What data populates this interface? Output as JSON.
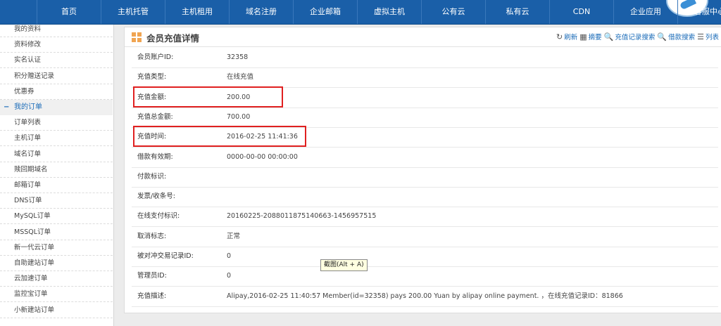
{
  "nav": {
    "items": [
      "首页",
      "主机托管",
      "主机租用",
      "域名注册",
      "企业邮箱",
      "虚拟主机",
      "公有云",
      "私有云",
      "CDN",
      "企业应用",
      "客服中心"
    ]
  },
  "sidebar": {
    "items_top": [
      "我的资料",
      "资料修改",
      "实名认证",
      "积分赠送记录",
      "优惠券"
    ],
    "group_label": "我的订单",
    "group_toggle": "−",
    "order_items": [
      "订单列表",
      "主机订单",
      "域名订单",
      "赎回期域名",
      "邮箱订单",
      "DNS订单",
      "MySQL订单",
      "MSSQL订单",
      "新一代云订单",
      "自助建站订单",
      "云加速订单",
      "监控宝订单",
      "小新建站订单"
    ]
  },
  "panel": {
    "title": "会员充值详情",
    "toolbar": [
      {
        "icon": "refresh-icon",
        "glyph": "↻",
        "label": "刷新"
      },
      {
        "icon": "summary-grid-icon",
        "glyph": "▦",
        "label": "摘要"
      },
      {
        "icon": "search-icon",
        "glyph": "🔍",
        "label": "充值记录搜索"
      },
      {
        "icon": "search-icon",
        "glyph": "🔍",
        "label": "借款搜索"
      },
      {
        "icon": "list-icon",
        "glyph": "☰",
        "label": "列表"
      }
    ]
  },
  "details": [
    {
      "label": "会员账户ID:",
      "value": "32358"
    },
    {
      "label": "充值类型:",
      "value": "在线充值"
    },
    {
      "label": "充值金额:",
      "value": "200.00"
    },
    {
      "label": "充值总金额:",
      "value": "700.00"
    },
    {
      "label": "充值时间:",
      "value": "2016-02-25 11:41:36"
    },
    {
      "label": "借款有效期:",
      "value": "0000-00-00 00:00:00"
    },
    {
      "label": "付款标识:",
      "value": ""
    },
    {
      "label": "发票/收条号:",
      "value": ""
    },
    {
      "label": "在线支付标识:",
      "value": "20160225-2088011875140663-1456957515"
    },
    {
      "label": "取消标志:",
      "value": "正常"
    },
    {
      "label": "被对冲交易记录ID:",
      "value": "0"
    },
    {
      "label": "管理员ID:",
      "value": "0"
    },
    {
      "label": "充值描述:",
      "value": "Alipay,2016-02-25 11:40:57 Member(id=32358) pays 200.00 Yuan by alipay online payment. ，在线充值记录ID：81866"
    }
  ],
  "tooltip": "截图(Alt + A)",
  "colors": {
    "nav": "#1a5fa8",
    "link": "#1a6bb8",
    "highlight": "#e02020"
  }
}
